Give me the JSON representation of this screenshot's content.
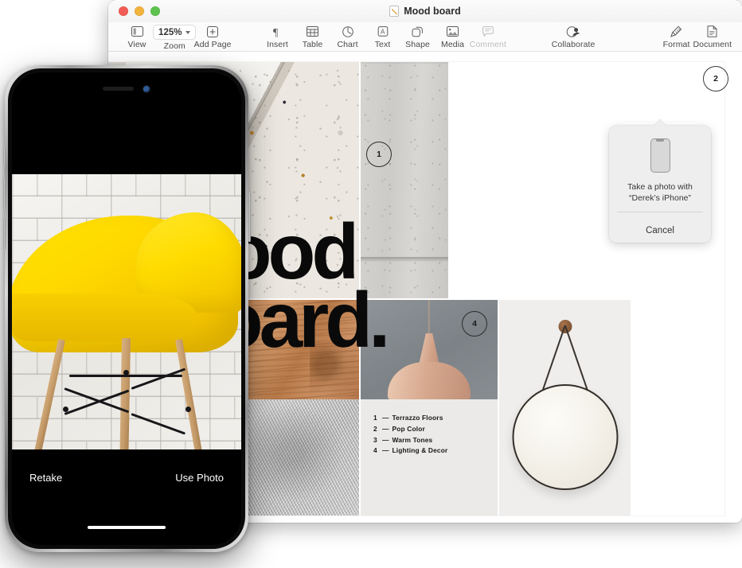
{
  "window": {
    "title": "Mood board",
    "traffic_lights": [
      {
        "name": "close",
        "color": "#f25c54"
      },
      {
        "name": "minimize",
        "color": "#f2b33d"
      },
      {
        "name": "zoom",
        "color": "#5dc24e"
      }
    ]
  },
  "toolbar": {
    "items": [
      {
        "label": "View",
        "icon": "sidebar-icon",
        "disabled": false
      },
      {
        "label": "Add Page",
        "icon": "plus-square-icon",
        "disabled": false
      },
      {
        "label": "Insert",
        "icon": "pilcrow-icon",
        "disabled": false
      },
      {
        "label": "Table",
        "icon": "table-icon",
        "disabled": false
      },
      {
        "label": "Chart",
        "icon": "chart-icon",
        "disabled": false
      },
      {
        "label": "Text",
        "icon": "text-box-icon",
        "disabled": false
      },
      {
        "label": "Shape",
        "icon": "shapes-icon",
        "disabled": false
      },
      {
        "label": "Media",
        "icon": "media-icon",
        "disabled": false
      },
      {
        "label": "Comment",
        "icon": "comment-icon",
        "disabled": true
      },
      {
        "label": "Collaborate",
        "icon": "collaborate-icon",
        "disabled": false
      },
      {
        "label": "Format",
        "icon": "format-brush-icon",
        "disabled": false
      },
      {
        "label": "Document",
        "icon": "document-icon",
        "disabled": false
      }
    ],
    "zoom": {
      "label": "Zoom",
      "value": "125%"
    }
  },
  "document": {
    "headline_line1": "Mood",
    "headline_line2": "Board.",
    "captions": [
      {
        "num": "1",
        "dash": "—",
        "text": "Terrazzo Floors"
      },
      {
        "num": "2",
        "dash": "—",
        "text": "Pop Color"
      },
      {
        "num": "3",
        "dash": "—",
        "text": "Warm Tones"
      },
      {
        "num": "4",
        "dash": "—",
        "text": "Lighting & Decor"
      }
    ],
    "markers": [
      {
        "id": "1",
        "label": "1"
      },
      {
        "id": "2",
        "label": "2"
      },
      {
        "id": "4",
        "label": "4"
      }
    ]
  },
  "popover": {
    "icon": "iphone-icon",
    "message_line1": "Take a photo with",
    "message_line2": "“Derek’s iPhone”",
    "cancel_label": "Cancel"
  },
  "iphone": {
    "retake_label": "Retake",
    "use_photo_label": "Use Photo"
  },
  "colors": {
    "accent_yellow": "#ffd900",
    "window_chrome": "#fbfbfb",
    "popover_bg": "#eeeeee",
    "headline": "#0a0a0a"
  }
}
